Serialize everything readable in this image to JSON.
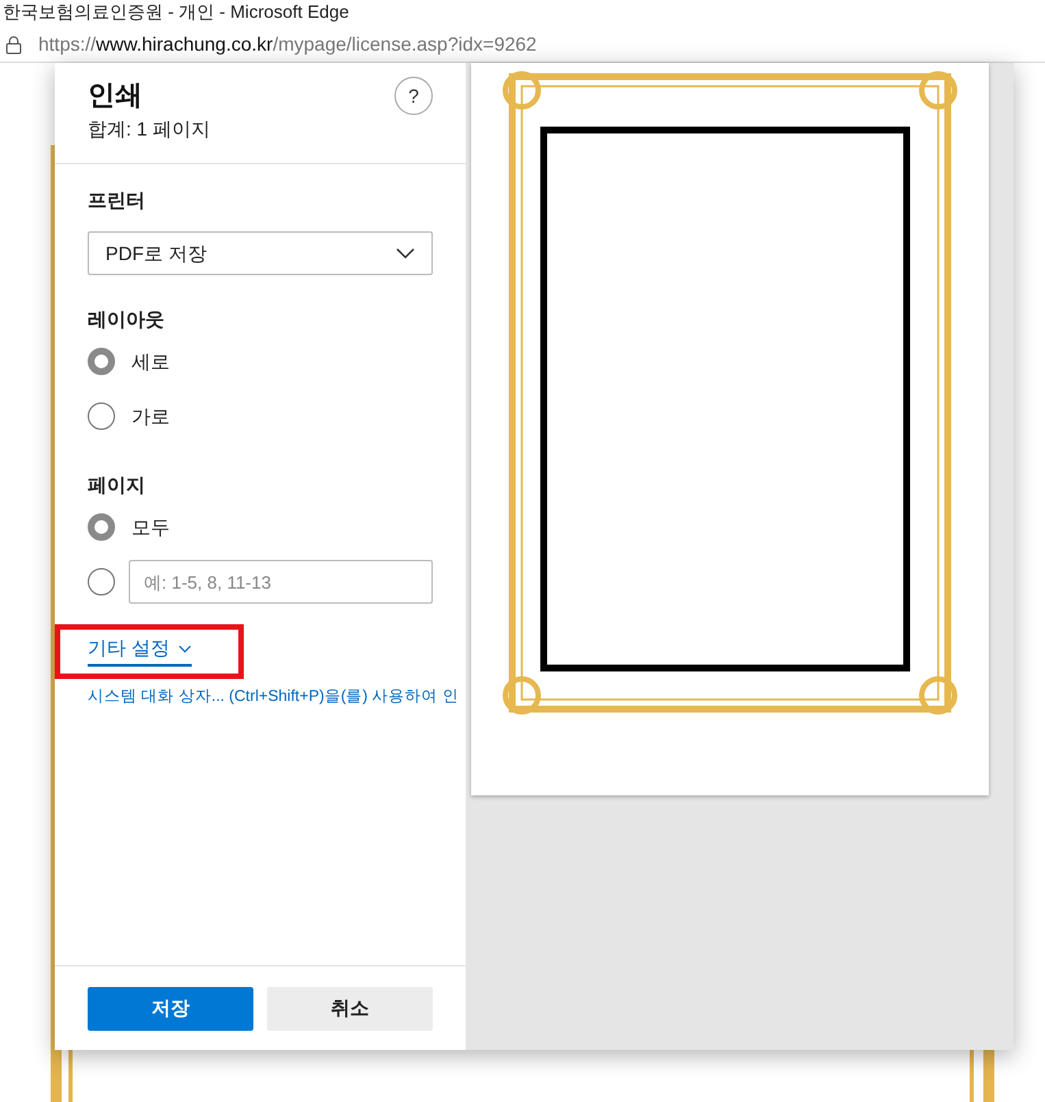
{
  "window": {
    "title": "한국보험의료인증원 - 개인 - Microsoft Edge"
  },
  "address_bar": {
    "scheme": "https://",
    "host": "www.hirachung.co.kr",
    "path": "/mypage/license.asp?idx=9262"
  },
  "print_dialog": {
    "title": "인쇄",
    "subtitle": "합계: 1 페이지",
    "help": "?",
    "printer": {
      "label": "프린터",
      "value": "PDF로 저장"
    },
    "layout": {
      "label": "레이아웃",
      "options": [
        {
          "label": "세로",
          "selected": true
        },
        {
          "label": "가로",
          "selected": false
        }
      ]
    },
    "pages": {
      "label": "페이지",
      "options": [
        {
          "kind": "all",
          "label": "모두",
          "selected": true
        },
        {
          "kind": "range",
          "placeholder": "예: 1-5, 8, 11-13",
          "selected": false
        }
      ]
    },
    "more_settings": {
      "label": "기타 설정",
      "highlighted": true
    },
    "system_dialog_link": "시스템 대화 상자... (Ctrl+Shift+P)을(를) 사용하여 인",
    "buttons": [
      {
        "kind": "primary",
        "label": "저장"
      },
      {
        "kind": "secondary",
        "label": "취소"
      }
    ]
  }
}
